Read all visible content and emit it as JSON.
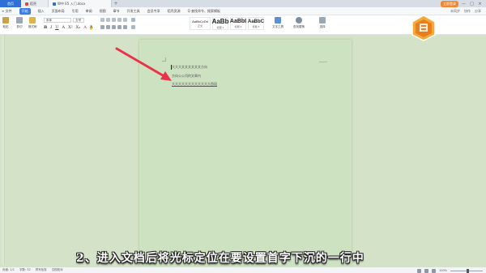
{
  "titlebar": {
    "tabs": [
      {
        "label": "首页",
        "color": "#2f6fd6"
      },
      {
        "label": "稻壳",
        "color": "#e0463a"
      },
      {
        "label": "W中 E5 入门.docx",
        "color": "#2f6fd6"
      }
    ],
    "new_tab": "+",
    "upgrade": "立即登录",
    "win_controls": [
      "—",
      "□",
      "×"
    ]
  },
  "menubar": {
    "items": [
      "≡ 文件",
      "开始",
      "插入",
      "页面布局",
      "引用",
      "审阅",
      "视图",
      "章节",
      "开发工具",
      "会员专享",
      "稻壳资源",
      "Q 查找命令、搜索模板"
    ],
    "active_index": 1,
    "right": [
      "未同步",
      "协作",
      "分享"
    ]
  },
  "ribbon": {
    "paste": "粘贴",
    "cut": "剪切",
    "format_painter": "格式刷",
    "font_name": "宋体",
    "font_size": "五号",
    "format_buttons": [
      "B",
      "I",
      "U",
      "A",
      "X²",
      "X₂",
      "A",
      "A"
    ],
    "styles": [
      {
        "sample": "AaBbCcDd",
        "label": "正文",
        "size": "4px"
      },
      {
        "sample": "AaBb",
        "label": "标题 1",
        "size": "8px"
      },
      {
        "sample": "AaBbI",
        "label": "标题 2",
        "size": "7px"
      },
      {
        "sample": "AaBbC",
        "label": "标题 3",
        "size": "6px"
      }
    ],
    "text_tools": "文字工具",
    "find_replace": "查找替换",
    "select": "选择"
  },
  "document": {
    "lines": [
      {
        "text": "大大大文文文文文文方向"
      },
      {
        "text": "方向公公司的文章内"
      },
      {
        "text": "大大大大大大大大大大大大首段"
      }
    ]
  },
  "subtitle": "2、进入文档后将光标定位在要设置首字下沉的一行中",
  "statusbar": {
    "page": "页面: 1/1",
    "words": "字数: 32",
    "spell": "拼写检查",
    "doc_check": "文档校对",
    "zoom": "100%"
  },
  "colors": {
    "arrow": "#e8334a",
    "accent": "#2f6fd6",
    "page_bg": "#cde2c1",
    "workspace_bg": "#d4e3c8"
  }
}
